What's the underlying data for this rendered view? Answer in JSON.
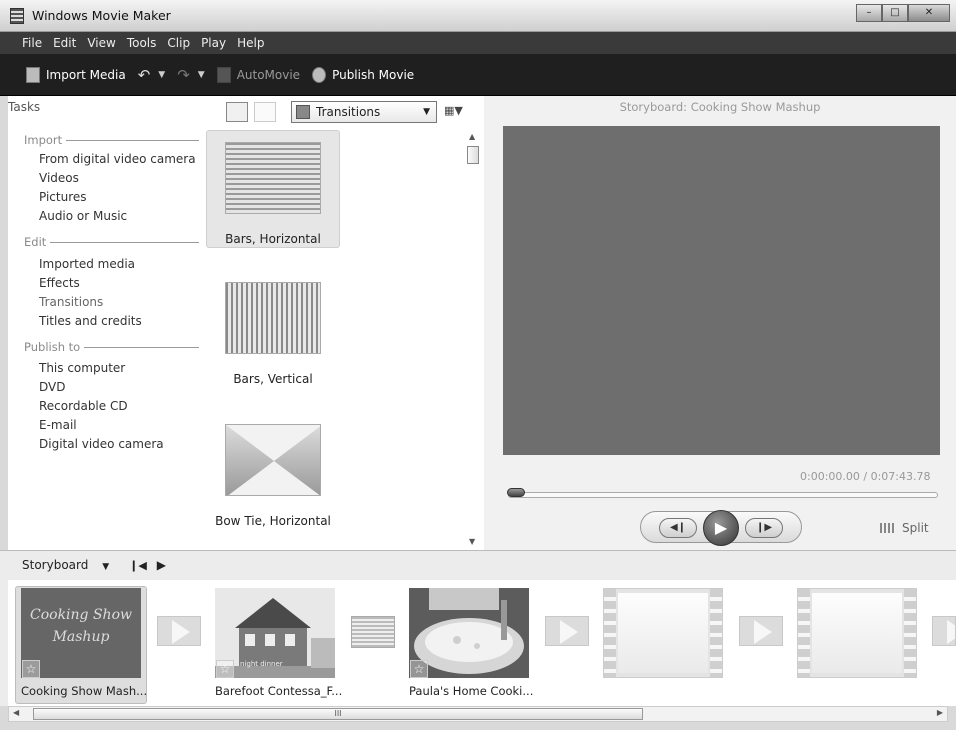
{
  "window": {
    "title": "Windows Movie Maker"
  },
  "menu": [
    "File",
    "Edit",
    "View",
    "Tools",
    "Clip",
    "Play",
    "Help"
  ],
  "toolbar": {
    "import_media": "Import Media",
    "automovie": "AutoMovie",
    "publish_movie": "Publish Movie"
  },
  "tasks": {
    "header": "Tasks",
    "import_head": "Import",
    "import_items": [
      "From digital video camera",
      "Videos",
      "Pictures",
      "Audio or Music"
    ],
    "edit_head": "Edit",
    "edit_items": [
      "Imported media",
      "Effects",
      "Transitions",
      "Titles and credits"
    ],
    "publish_head": "Publish to",
    "publish_items": [
      "This computer",
      "DVD",
      "Recordable CD",
      "E-mail",
      "Digital video camera"
    ]
  },
  "collection": {
    "dropdown": "Transitions",
    "items": [
      "Bars, Horizontal",
      "Bars, Vertical",
      "Bow Tie, Horizontal"
    ]
  },
  "preview": {
    "title": "Storyboard: Cooking Show Mashup",
    "timecode": "0:00:00.00 / 0:07:43.78",
    "split": "Split"
  },
  "storyboard": {
    "label": "Storyboard",
    "title_card": "Cooking Show Mashup",
    "clip_labels": [
      "Cooking Show Mash...",
      "Barefoot Contessa_F...",
      "Paula's Home Cooki..."
    ],
    "thumb_caption": "night dinner",
    "scroll_grip": "III"
  }
}
